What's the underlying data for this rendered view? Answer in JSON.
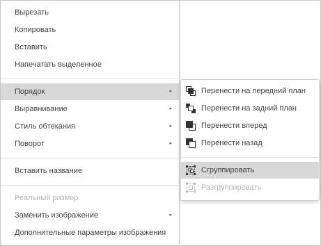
{
  "context_menu": {
    "items": [
      {
        "label": "Вырезать"
      },
      {
        "label": "Копировать"
      },
      {
        "label": "Вставить"
      },
      {
        "label": "Напечатать выделенное"
      },
      {
        "label": "Порядок"
      },
      {
        "label": "Выравнивание"
      },
      {
        "label": "Стиль обтекания"
      },
      {
        "label": "Поворот"
      },
      {
        "label": "Вставить название"
      },
      {
        "label": "Реальный размер"
      },
      {
        "label": "Заменить изображение"
      },
      {
        "label": "Дополнительные параметры изображения"
      }
    ],
    "submenu_arrow": "▸"
  },
  "submenu": {
    "items": [
      {
        "label": "Перенести на передний план",
        "icon": "bring-to-front-icon"
      },
      {
        "label": "Перенести на задний план",
        "icon": "send-to-back-icon"
      },
      {
        "label": "Перенести вперед",
        "icon": "bring-forward-icon"
      },
      {
        "label": "Перенести назад",
        "icon": "send-backward-icon"
      },
      {
        "label": "Сгруппировать",
        "icon": "group-icon"
      },
      {
        "label": "Разгруппировать",
        "icon": "ungroup-icon"
      }
    ]
  },
  "colors": {
    "hover_bg": "#d8d8d8",
    "text": "#444444",
    "disabled_text": "#b5b5b5",
    "icon_dark": "#333333"
  }
}
